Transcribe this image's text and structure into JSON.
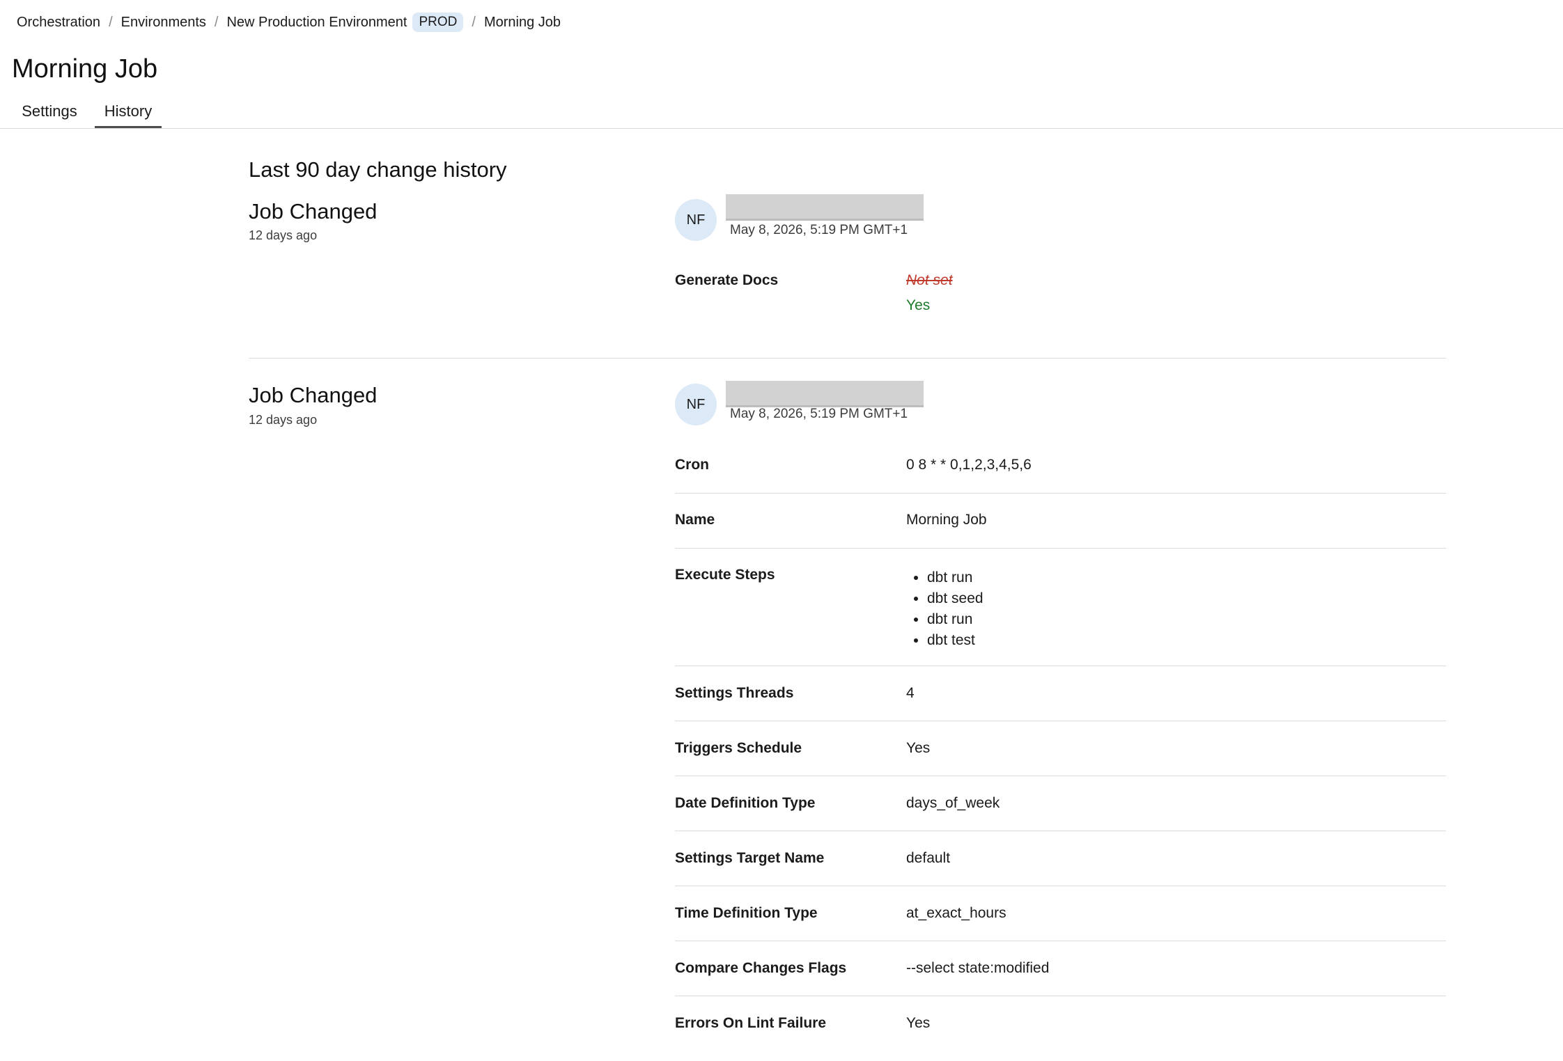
{
  "breadcrumb": {
    "items": [
      "Orchestration",
      "Environments",
      "New Production Environment"
    ],
    "badge": "PROD",
    "current": "Morning Job",
    "separator": "/"
  },
  "page": {
    "title": "Morning Job"
  },
  "tabs": [
    {
      "label": "Settings",
      "active": false
    },
    {
      "label": "History",
      "active": true
    }
  ],
  "history": {
    "title": "Last 90 day change history",
    "entries": [
      {
        "title": "Job Changed",
        "ago": "12 days ago",
        "avatar": "NF",
        "timestamp": "May 8, 2026, 5:19 PM GMT+1",
        "changes": [
          {
            "label": "Generate Docs",
            "old": "Not set",
            "new": "Yes"
          }
        ]
      },
      {
        "title": "Job Changed",
        "ago": "12 days ago",
        "avatar": "NF",
        "timestamp": "May 8, 2026, 5:19 PM GMT+1",
        "fields": [
          {
            "label": "Cron",
            "value": "0 8 * * 0,1,2,3,4,5,6"
          },
          {
            "label": "Name",
            "value": "Morning Job"
          },
          {
            "label": "Execute Steps",
            "steps": [
              "dbt run",
              "dbt seed",
              "dbt run",
              "dbt test"
            ]
          },
          {
            "label": "Settings Threads",
            "value": "4"
          },
          {
            "label": "Triggers Schedule",
            "value": "Yes"
          },
          {
            "label": "Date Definition Type",
            "value": "days_of_week"
          },
          {
            "label": "Settings Target Name",
            "value": "default"
          },
          {
            "label": "Time Definition Type",
            "value": "at_exact_hours"
          },
          {
            "label": "Compare Changes Flags",
            "value": "--select state:modified"
          },
          {
            "label": "Errors On Lint Failure",
            "value": "Yes"
          }
        ]
      }
    ]
  },
  "colors": {
    "accent_badge": "#dce9f7",
    "old_value": "#c0392b",
    "new_value": "#1d7d2e",
    "divider": "#dcdcdc"
  }
}
